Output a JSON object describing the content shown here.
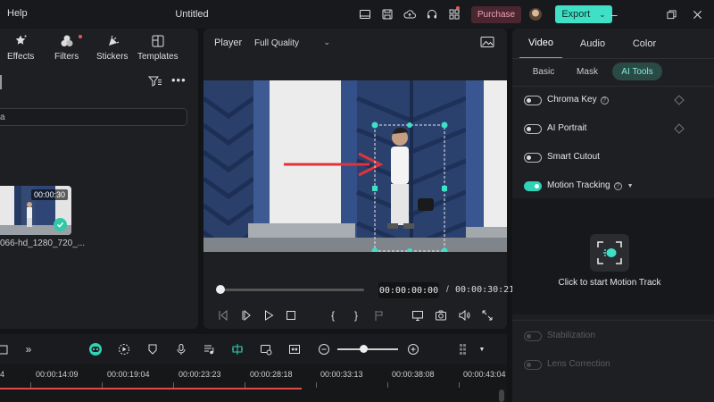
{
  "titlebar": {
    "menu_help": "Help",
    "title": "Untitled",
    "purchase_label": "Purchase",
    "export_label": "Export"
  },
  "media_tabs": [
    {
      "label": "Effects",
      "icon": "effects-icon"
    },
    {
      "label": "Filters",
      "icon": "filters-icon"
    },
    {
      "label": "Stickers",
      "icon": "stickers-icon"
    },
    {
      "label": "Templates",
      "icon": "templates-icon"
    }
  ],
  "media": {
    "search_text": "a",
    "clip_duration": "00:00:30",
    "clip_name": "066-hd_1280_720_..."
  },
  "player": {
    "label": "Player",
    "quality": "Full Quality",
    "current_time": "00:00:00:00",
    "separator": "/",
    "total_time": "00:00:30:21"
  },
  "right_panel": {
    "tabs": [
      "Video",
      "Audio",
      "Color"
    ],
    "subtabs": [
      "Basic",
      "Mask",
      "AI Tools"
    ],
    "features": [
      {
        "label": "Chroma Key",
        "on": false
      },
      {
        "label": "AI Portrait",
        "on": false
      },
      {
        "label": "Smart Cutout",
        "on": false
      },
      {
        "label": "Motion Tracking",
        "on": true
      }
    ],
    "tracking_prompt": "Click to start Motion Track",
    "disabled_features": [
      "Stabilization",
      "Lens Correction"
    ]
  },
  "timeline": {
    "ticks": [
      "4",
      "00:00:14:09",
      "00:00:19:04",
      "00:00:23:23",
      "00:00:28:18",
      "00:00:33:13",
      "00:00:38:08",
      "00:00:43:04"
    ],
    "zoom_level": 0.43
  },
  "colors": {
    "accent": "#2fd3b5",
    "export_bg": "#3fe0c5",
    "purchase_bg": "#4a2631",
    "playhead": "#e04a4a"
  }
}
